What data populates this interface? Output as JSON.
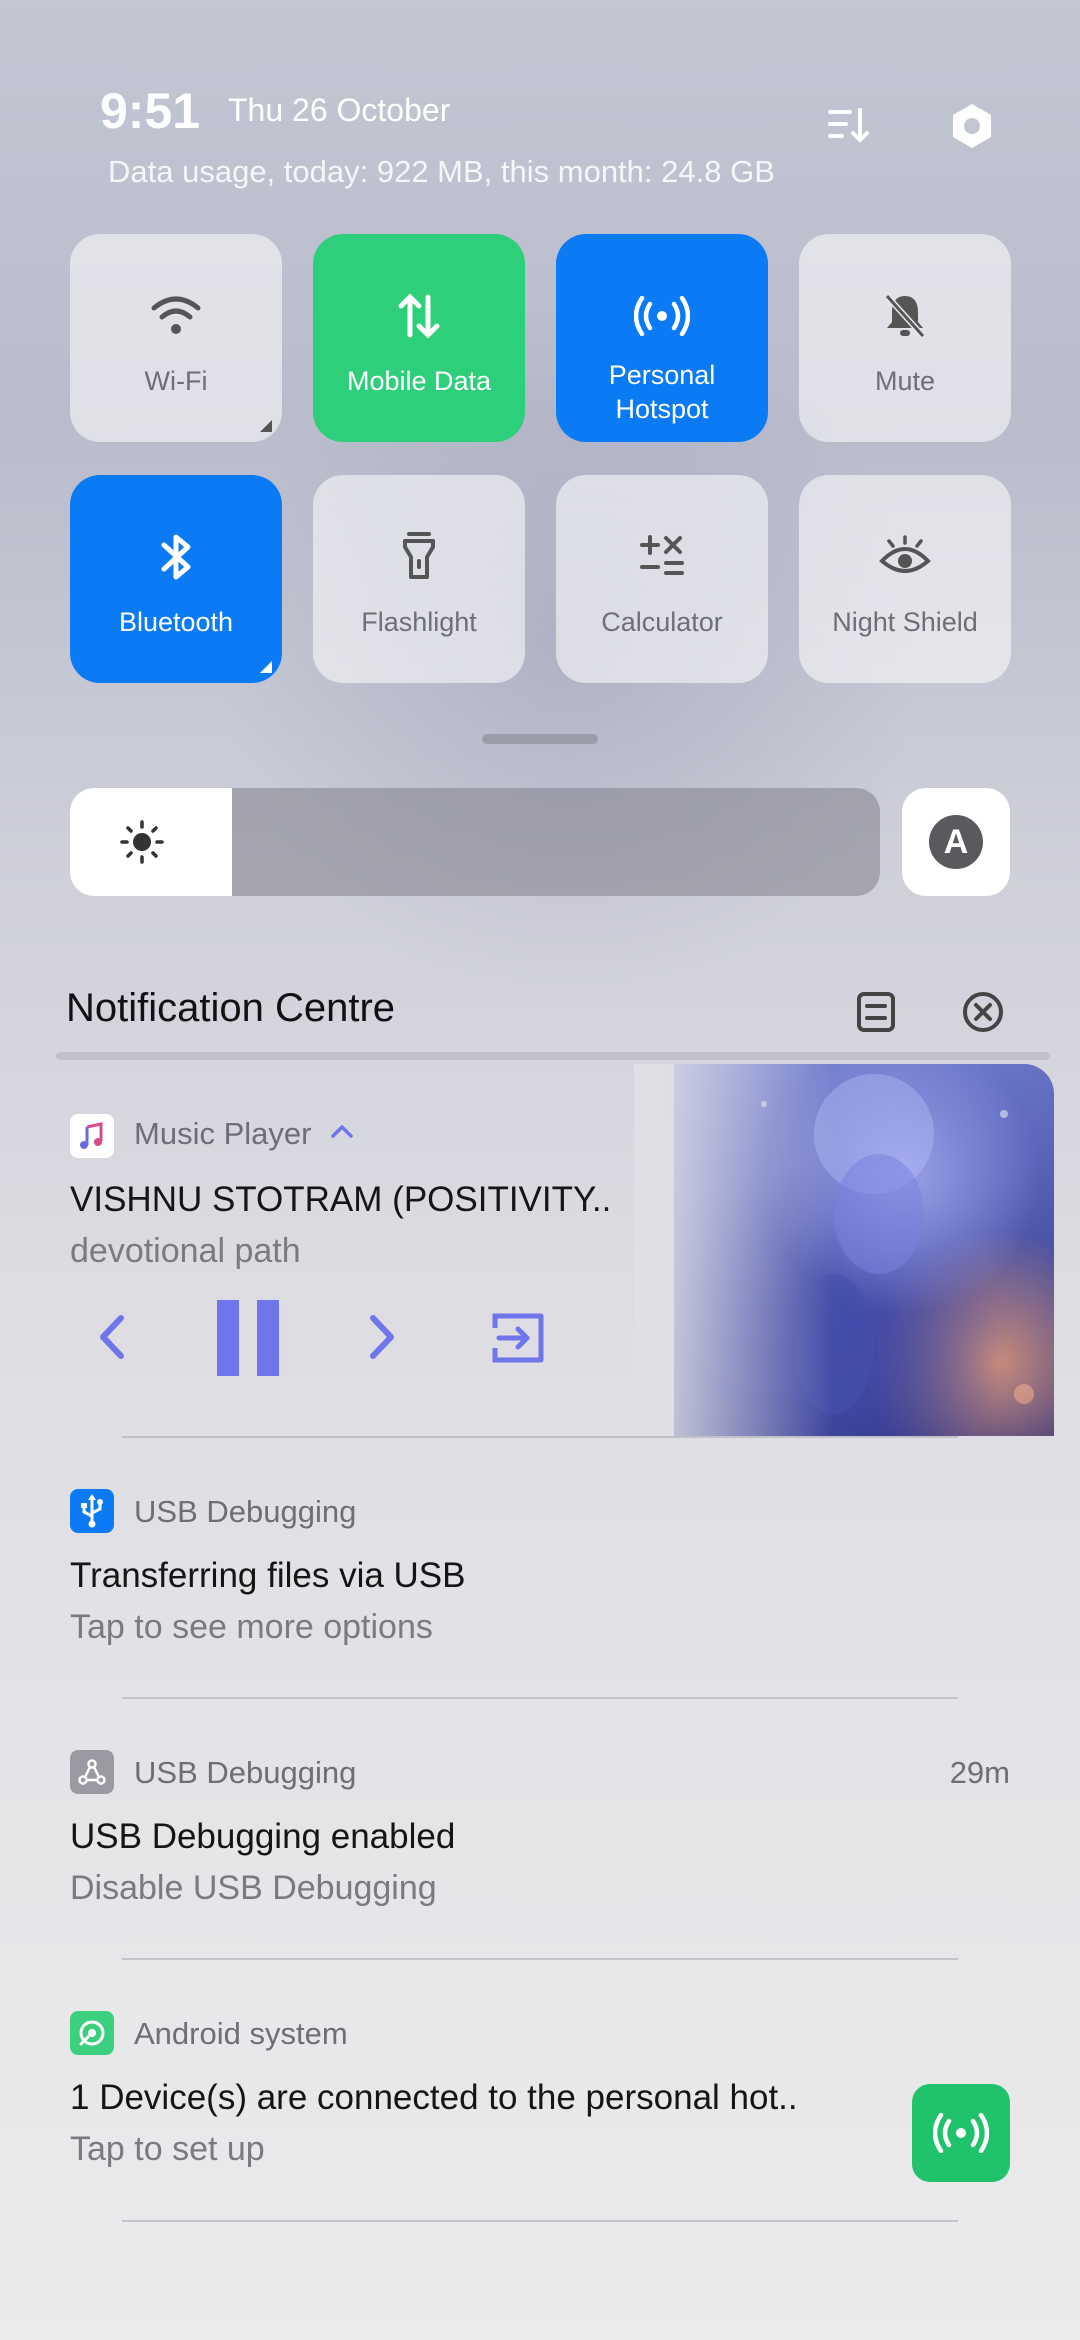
{
  "header": {
    "time": "9:51",
    "date": "Thu 26 October",
    "data_usage": "Data usage, today: 922 MB, this month: 24.8 GB",
    "icons": [
      "sort-icon",
      "settings-icon"
    ]
  },
  "tiles": [
    {
      "label": "Wi-Fi",
      "icon": "wifi-icon",
      "state": "off"
    },
    {
      "label": "Mobile Data",
      "icon": "mobile-data-icon",
      "state": "on",
      "color": "#2ecf7a"
    },
    {
      "label": "Personal Hotspot",
      "icon": "hotspot-icon",
      "state": "on",
      "color": "#0a7bf5"
    },
    {
      "label": "Mute",
      "icon": "bell-off-icon",
      "state": "off"
    },
    {
      "label": "Bluetooth",
      "icon": "bluetooth-icon",
      "state": "on",
      "color": "#0a7bf5"
    },
    {
      "label": "Flashlight",
      "icon": "flashlight-icon",
      "state": "off"
    },
    {
      "label": "Calculator",
      "icon": "calculator-icon",
      "state": "off"
    },
    {
      "label": "Night Shield",
      "icon": "eye-icon",
      "state": "off"
    }
  ],
  "brightness": {
    "level": 0.2,
    "auto_label": "A"
  },
  "notification_centre": {
    "title": "Notification Centre"
  },
  "music": {
    "app_name": "Music Player",
    "title": "VISHNU STOTRAM (POSITIVITY..",
    "artist": "devotional path",
    "accent": "#6f75ea"
  },
  "notifications": [
    {
      "app": "USB Debugging",
      "title": "Transferring files via USB",
      "subtitle": "Tap to see more options",
      "time": ""
    },
    {
      "app": "USB Debugging",
      "title": "USB Debugging enabled",
      "subtitle": "Disable USB Debugging",
      "time": "29m"
    },
    {
      "app": "Android system",
      "title": "1 Device(s) are connected to the personal hot..",
      "subtitle": "Tap to set up",
      "time": ""
    }
  ]
}
